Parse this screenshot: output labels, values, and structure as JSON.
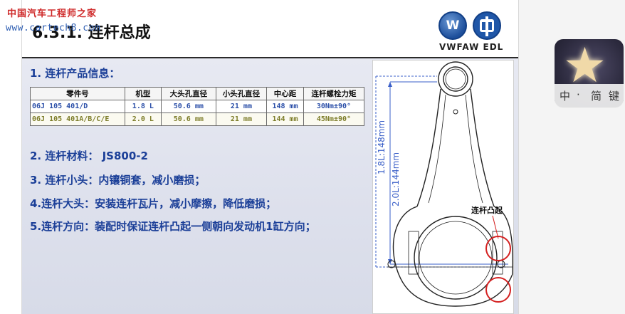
{
  "watermark": {
    "site_name": "中国汽车工程师之家",
    "url": "www.cartech8.com"
  },
  "slide": {
    "title": "6.3.1.  连杆总成",
    "logo_text": "VWFAW EDL",
    "section_heading": "1. 连杆产品信息：",
    "table": {
      "headers": [
        "零件号",
        "机型",
        "大头孔直径",
        "小头孔直径",
        "中心距",
        "连杆螺栓力矩"
      ],
      "rows": [
        [
          "06J 105 401/D",
          "1.8 L",
          "50.6 mm",
          "21 mm",
          "148 mm",
          "30Nm±90°"
        ],
        [
          "06J 105 401A/B/C/E",
          "2.0 L",
          "50.6 mm",
          "21 mm",
          "144 mm",
          "45Nm±90°"
        ]
      ]
    },
    "items": [
      "2. 连杆材料：  JS800-2",
      "3. 连杆小头：内镶铜套，减小磨损；",
      "4.连杆大头：安装连杆瓦片，减小摩擦，降低磨损；",
      "5.连杆方向：装配时保证连杆凸起一侧朝向发动机1缸方向；"
    ],
    "figure": {
      "dim_label_1": "1.8L:148mm",
      "dim_label_2": "2.0L:144mm",
      "callout_label": "连杆凸起"
    }
  },
  "ime_toolbar": {
    "keys": [
      "中",
      "·",
      "简",
      "键"
    ]
  },
  "colors": {
    "heading_blue": "#1b3f98",
    "row1_text": "#2b4fa8",
    "row2_text": "#7d7d2a",
    "callout_red": "#d42020",
    "dimension_blue": "#3a5fc8"
  }
}
